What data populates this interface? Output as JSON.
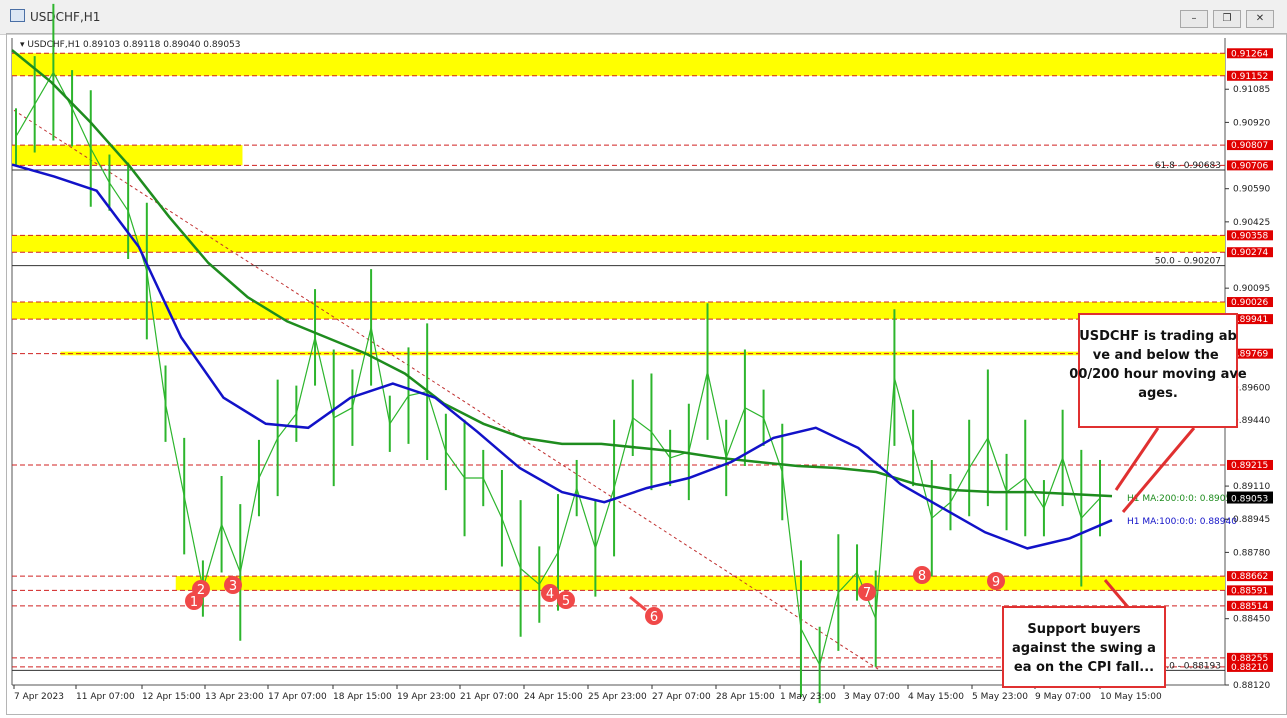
{
  "window": {
    "title": "USDCHF,H1",
    "buttons": [
      "minimize",
      "restore",
      "close"
    ]
  },
  "chart_info": "USDCHF,H1  0.89103 0.89118 0.89040 0.89053",
  "colors": {
    "zone": "#ffff00",
    "ma200": "#1e8c1e",
    "ma100": "#1212c8",
    "candle": "#2db52d",
    "callout_border": "#e03030",
    "marker": "#f04848",
    "level_line": "#d02020",
    "price_label_red": "#e00000"
  },
  "chart_data": {
    "type": "line",
    "title": "USDCHF,H1",
    "ylim": [
      0.8812,
      0.9134
    ],
    "x_ticks": [
      "7 Apr 2023",
      "11 Apr 07:00",
      "12 Apr 15:00",
      "13 Apr 23:00",
      "17 Apr 07:00",
      "18 Apr 15:00",
      "19 Apr 23:00",
      "21 Apr 07:00",
      "24 Apr 15:00",
      "25 Apr 23:00",
      "27 Apr 07:00",
      "28 Apr 15:00",
      "1 May 23:00",
      "3 May 07:00",
      "4 May 15:00",
      "5 May 23:00",
      "9 May 07:00",
      "10 May 15:00"
    ],
    "y_ticks": [
      "0.91085",
      "0.90920",
      "0.90590",
      "0.90425",
      "0.90095",
      "0.89600",
      "0.89440",
      "0.89110",
      "0.88945",
      "0.88780",
      "0.88450",
      "0.88120"
    ],
    "price_labels_red": [
      "0.91264",
      "0.91152",
      "0.90807",
      "0.90706",
      "0.90358",
      "0.90274",
      "0.90026",
      "0.89941",
      "0.89769",
      "0.89215",
      "0.88662",
      "0.88591",
      "0.88514",
      "0.88255",
      "0.88210"
    ],
    "current_price": "0.89053",
    "ma_labels": {
      "ma200": "H1 MA:200:0:0: 0.89056",
      "ma100": "H1 MA:100:0:0: 0.88940"
    },
    "fib_labels": {
      "f618": "61.8 - 0.90683",
      "f50": "50.0 - 0.90207",
      "f0": "0.0 - 0.88193"
    },
    "zones": [
      {
        "from": 0.91152,
        "to": 0.91264
      },
      {
        "from": 0.90706,
        "to": 0.90807,
        "x_end": 0.19
      },
      {
        "from": 0.90274,
        "to": 0.90358
      },
      {
        "from": 0.89941,
        "to": 0.90026
      },
      {
        "from": 0.89761,
        "to": 0.89779,
        "x_start": 0.04
      },
      {
        "from": 0.88591,
        "to": 0.88662,
        "x_start": 0.135
      }
    ],
    "series": [
      {
        "name": "USDCHF",
        "values": [
          0.9085,
          0.9101,
          0.9117,
          0.9099,
          0.9079,
          0.9062,
          0.9048,
          0.9018,
          0.8952,
          0.8906,
          0.886,
          0.8892,
          0.8868,
          0.8915,
          0.8935,
          0.8947,
          0.8985,
          0.8945,
          0.895,
          0.899,
          0.8942,
          0.8956,
          0.8958,
          0.8928,
          0.8915,
          0.8915,
          0.8895,
          0.887,
          0.8862,
          0.8878,
          0.891,
          0.888,
          0.891,
          0.8945,
          0.8938,
          0.8925,
          0.8928,
          0.8968,
          0.8925,
          0.895,
          0.8945,
          0.8918,
          0.884,
          0.8822,
          0.8858,
          0.8868,
          0.8845,
          0.8965,
          0.893,
          0.8895,
          0.8903,
          0.892,
          0.8935,
          0.8908,
          0.8915,
          0.89,
          0.8925,
          0.8895,
          0.8905
        ]
      },
      {
        "name": "H1 MA:200",
        "values": [
          0.9128,
          0.9112,
          0.9092,
          0.907,
          0.9045,
          0.9022,
          0.9005,
          0.8993,
          0.8985,
          0.8977,
          0.8967,
          0.8952,
          0.8942,
          0.8935,
          0.8932,
          0.8932,
          0.893,
          0.8928,
          0.8925,
          0.8923,
          0.8921,
          0.892,
          0.8918,
          0.8912,
          0.8909,
          0.8908,
          0.8908,
          0.8907,
          0.8906
        ]
      },
      {
        "name": "H1 MA:100",
        "values": [
          0.9071,
          0.9065,
          0.9058,
          0.903,
          0.8985,
          0.8955,
          0.8942,
          0.894,
          0.8955,
          0.8962,
          0.8955,
          0.8938,
          0.892,
          0.8908,
          0.8903,
          0.891,
          0.8915,
          0.8923,
          0.8935,
          0.894,
          0.893,
          0.8912,
          0.89,
          0.8888,
          0.888,
          0.8885,
          0.8894
        ]
      }
    ],
    "markers": [
      "1",
      "2",
      "3",
      "4",
      "5",
      "6",
      "7",
      "8",
      "9"
    ],
    "callout_top": "USDCHF is trading above and below the 100/200 hour moving averages.",
    "callout_bottom": "Support buyers against the swing area on the CPI fall..."
  }
}
